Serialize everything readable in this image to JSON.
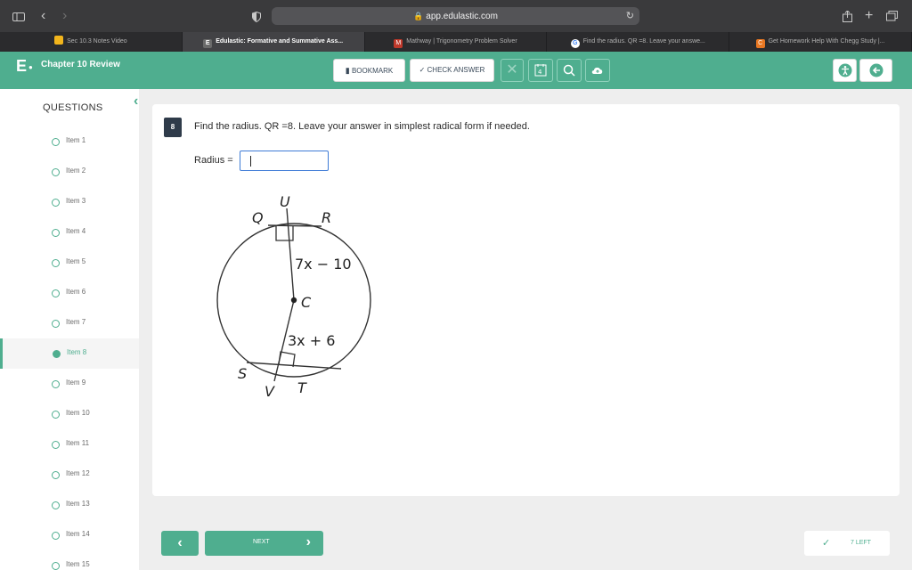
{
  "browser": {
    "url": "app.edulastic.com",
    "tabs": [
      {
        "label": "Sec 10.3 Notes Video",
        "icon": "classroom-icon",
        "color": "#f2b51c"
      },
      {
        "label": "Edulastic: Formative and Summative Ass...",
        "icon": "edulastic-icon",
        "color": "#6a6a6a"
      },
      {
        "label": "Mathway | Trigonometry Problem Solver",
        "icon": "mathway-icon",
        "color": "#c0392b"
      },
      {
        "label": "Find the radius. QR =8. Leave your answe...",
        "icon": "google-icon",
        "color": "#ffffff"
      },
      {
        "label": "Get Homework Help With Chegg Study |...",
        "icon": "chegg-icon",
        "color": "#e87722"
      }
    ]
  },
  "header": {
    "logo": "E",
    "title": "Chapter 10 Review",
    "bookmark_label": "BOOKMARK",
    "check_answer_label": "CHECK ANSWER"
  },
  "sidebar": {
    "title": "QUESTIONS",
    "items": [
      {
        "label": "Item 1"
      },
      {
        "label": "Item 2"
      },
      {
        "label": "Item 3"
      },
      {
        "label": "Item 4"
      },
      {
        "label": "Item 5"
      },
      {
        "label": "Item 6"
      },
      {
        "label": "Item 7"
      },
      {
        "label": "Item 8"
      },
      {
        "label": "Item 9"
      },
      {
        "label": "Item 10"
      },
      {
        "label": "Item 11"
      },
      {
        "label": "Item 12"
      },
      {
        "label": "Item 13"
      },
      {
        "label": "Item 14"
      },
      {
        "label": "Item 15"
      }
    ],
    "active_index": 7
  },
  "question": {
    "number": "8",
    "text": "Find the radius. QR =8. Leave your answer in simplest radical form if needed.",
    "answer_label": "Radius =",
    "answer_value": ""
  },
  "figure": {
    "labels": {
      "U": "U",
      "Q": "Q",
      "R": "R",
      "C": "C",
      "S": "S",
      "V": "V",
      "T": "T"
    },
    "top_segment": "7x − 10",
    "bottom_segment": "3x + 6"
  },
  "footer": {
    "next_label": "NEXT",
    "left_label": "7 LEFT"
  },
  "colors": {
    "accent": "#4fae8f",
    "toolbar": "#3a3a3c",
    "question_badge": "#2f3b4a"
  }
}
